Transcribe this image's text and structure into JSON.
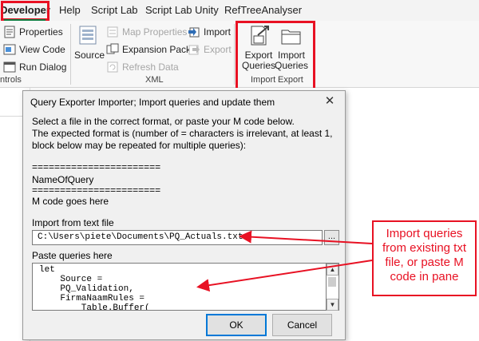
{
  "ribbon": {
    "tabs": [
      "Developer",
      "Help",
      "Script Lab",
      "Script Lab Unity",
      "RefTreeAnalyser"
    ],
    "controls_group": {
      "properties": "Properties",
      "view_code": "View Code",
      "run_dialog": "Run Dialog",
      "label": "ntrols"
    },
    "xml_group": {
      "source": "Source",
      "map_properties": "Map Properties",
      "expansion_packs": "Expansion Packs",
      "refresh_data": "Refresh Data",
      "import": "Import",
      "export": "Export",
      "label": "XML"
    },
    "import_export_group": {
      "export_queries": [
        "Export",
        "Queries"
      ],
      "import_queries": [
        "Import",
        "Queries"
      ],
      "label_import": "Import",
      "label_export": "Export"
    }
  },
  "dialog": {
    "title": "Query Exporter Importer; Import queries and update them",
    "close": "✕",
    "instructions": [
      "Select a file in the correct format, or paste your M code below.",
      "The expected format is (number of = characters is irrelevant, at least 1,",
      "block below may be repeated for multiple queries):"
    ],
    "format_lines": [
      "=======================",
      "NameOfQuery",
      "=======================",
      "M code goes here"
    ],
    "import_label": "Import from text file",
    "file_path": "C:\\Users\\piete\\Documents\\PQ_Actuals.txt",
    "browse_label": "...",
    "paste_label": "Paste queries here",
    "code_lines": [
      "let",
      "    Source =",
      "    PQ_Validation,",
      "    FirmaNaamRules =",
      "        Table.Buffer("
    ],
    "ok_label": "OK",
    "cancel_label": "Cancel"
  },
  "callout": {
    "text": [
      "Import queries",
      "from existing txt",
      "file, or paste M",
      "code in pane"
    ]
  },
  "colors": {
    "highlight_red": "#e81123",
    "excel_green": "#107c41",
    "ok_focus": "#0078d7"
  }
}
